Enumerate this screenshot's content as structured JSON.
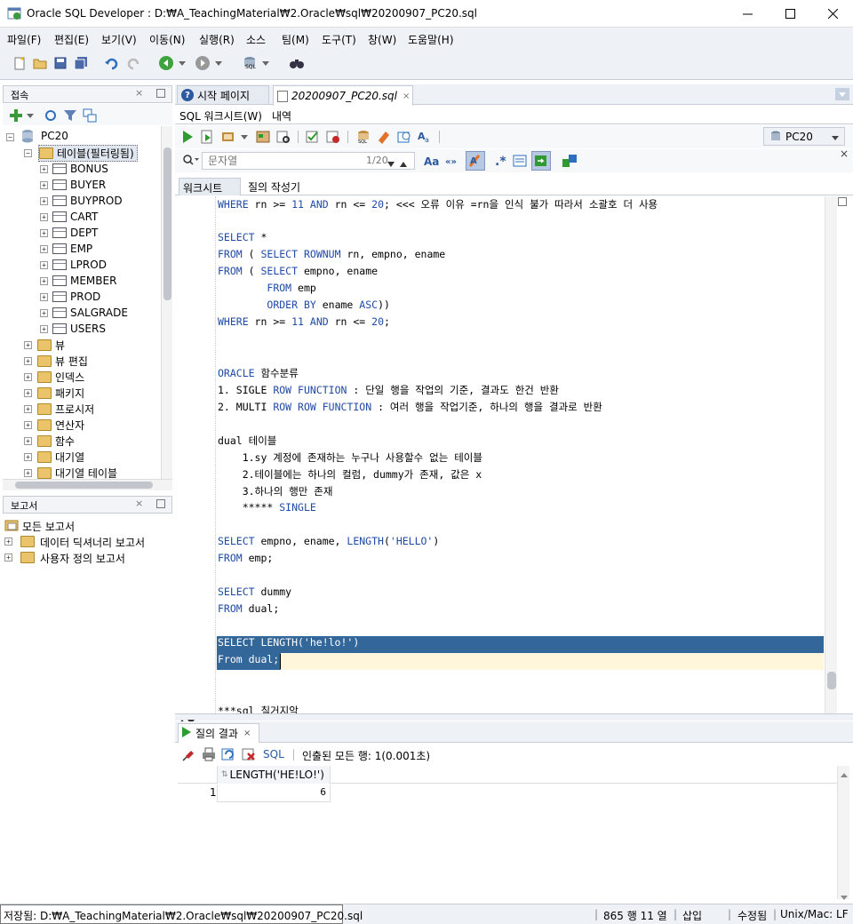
{
  "window": {
    "title": "Oracle SQL Developer : D:₩A_TeachingMaterial₩2.Oracle₩sql₩20200907_PC20.sql"
  },
  "menu": [
    "파일(F)",
    "편집(E)",
    "보기(V)",
    "이동(N)",
    "실행(R)",
    "소스",
    "팀(M)",
    "도구(T)",
    "창(W)",
    "도움말(H)"
  ],
  "connections_panel": {
    "title": "접속",
    "root": "PC20",
    "tables_node": "테이블(필터링됨)",
    "tables": [
      "BONUS",
      "BUYER",
      "BUYPROD",
      "CART",
      "DEPT",
      "EMP",
      "LPROD",
      "MEMBER",
      "PROD",
      "SALGRADE",
      "USERS"
    ],
    "other_nodes": [
      "뷰",
      "뷰 편집",
      "인덱스",
      "패키지",
      "프로시저",
      "연산자",
      "함수",
      "대기열",
      "대기열 테이블"
    ]
  },
  "reports_panel": {
    "title": "보고서",
    "items": [
      "모든 보고서",
      "데이터 딕셔너리 보고서",
      "사용자 정의 보고서"
    ]
  },
  "editor": {
    "tabs": [
      "시작 페이지",
      "20200907_PC20.sql"
    ],
    "subtabs": [
      "SQL 워크시트(W)",
      "내역"
    ],
    "connection": "PC20",
    "search_placeholder": "문자열",
    "search_count": "1/20",
    "worksheet_tabs": [
      "워크시트",
      "질의 작성기"
    ],
    "lines": [
      "WHERE rn >= 11 AND rn <= 20; <<< 오류 이유 =rn을 인식 불가 따라서 소괄호 더 사용",
      "",
      "SELECT *",
      "FROM ( SELECT ROWNUM rn, empno, ename",
      "FROM ( SELECT empno, ename",
      "        FROM emp",
      "        ORDER BY ename ASC))",
      "WHERE rn >= 11 AND rn <= 20;",
      "",
      "",
      "ORACLE 함수분류",
      "1. SIGLE ROW FUNCTION : 단일 행을 작업의 기준, 결과도 한건 반환",
      "2. MULTI ROW ROW FUNCTION : 여러 행을 작업기준, 하나의 행을 결과로 반환",
      "",
      "dual 테이블",
      "    1.sy 계정에 존재하는 누구나 사용할수 없는 테이블",
      "    2.테이블에는 하나의 컬럼, dummy가 존재, 값은 x",
      "    3.하나의 행만 존재",
      "    ***** SINGLE",
      "",
      "SELECT empno, ename, LENGTH('HELLO')",
      "FROM emp;",
      "",
      "SELECT dummy",
      "FROM dual;",
      "",
      "SELECT LENGTH('he!lo!')",
      "From dual;",
      "",
      "",
      "***sql 칠거지악"
    ]
  },
  "results": {
    "tab": "질의 결과",
    "sql_label": "SQL",
    "status": "인출된 모든 행: 1(0.001초)",
    "column": "LENGTH('HE!LO!')",
    "rows": [
      {
        "num": "1",
        "value": "6"
      }
    ]
  },
  "statusbar": {
    "path": "저장됨: D:₩A_TeachingMaterial₩2.Oracle₩sql₩20200907_PC20.sql",
    "position": "865 행 11 열",
    "mode": "삽입",
    "modified": "수정됨",
    "eol": "Unix/Mac: LF"
  },
  "colors": {
    "selection": "#336699",
    "current_line": "#fff6dc",
    "keyword": "#1f4aa6",
    "chrome": "#eef1f6"
  }
}
